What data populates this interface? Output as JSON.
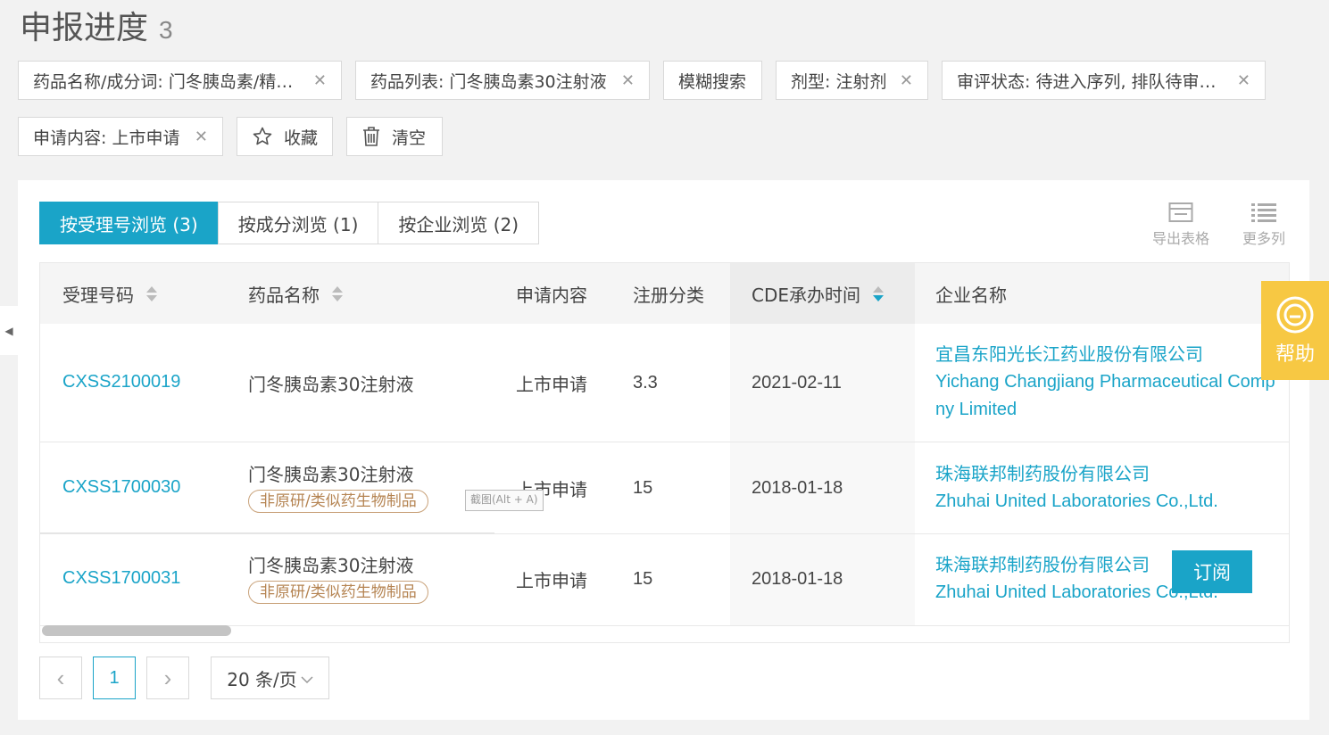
{
  "title": "申报进度",
  "result_count": "3",
  "filters": [
    {
      "label": "药品名称/成分词: 门冬胰岛素/精…",
      "removable": true
    },
    {
      "label": "药品列表: 门冬胰岛素30注射液",
      "removable": true
    },
    {
      "label": "模糊搜索",
      "removable": false
    },
    {
      "label": "剂型: 注射剂",
      "removable": true
    },
    {
      "label": "审评状态: 待进入序列, 排队待审…",
      "removable": true
    },
    {
      "label": "申请内容: 上市申请",
      "removable": true
    }
  ],
  "actions": {
    "favorite": "收藏",
    "clear": "清空"
  },
  "tabs": [
    {
      "label": "按受理号浏览 (3)",
      "active": true
    },
    {
      "label": "按成分浏览 (1)",
      "active": false
    },
    {
      "label": "按企业浏览 (2)",
      "active": false
    }
  ],
  "tools": {
    "export": "导出表格",
    "more_columns": "更多列"
  },
  "columns": [
    "受理号码",
    "药品名称",
    "申请内容",
    "注册分类",
    "CDE承办时间",
    "企业名称"
  ],
  "rows": [
    {
      "id": "CXSS2100019",
      "drug": "门冬胰岛素30注射液",
      "tag": "",
      "apply": "上市申请",
      "class": "3.3",
      "date": "2021-02-11",
      "company_cn": "宜昌东阳光长江药业股份有限公司",
      "company_en_1": "Yichang Changjiang Pharmaceutical Comp",
      "company_en_2": "ny Limited"
    },
    {
      "id": "CXSS1700030",
      "drug": "门冬胰岛素30注射液",
      "tag": "非原研/类似药生物制品",
      "apply": "上市申请",
      "class": "15",
      "date": "2018-01-18",
      "company_cn": "珠海联邦制药股份有限公司",
      "company_en_1": "Zhuhai United Laboratories Co.,Ltd.",
      "company_en_2": ""
    },
    {
      "id": "CXSS1700031",
      "drug": "门冬胰岛素30注射液",
      "tag": "非原研/类似药生物制品",
      "apply": "上市申请",
      "class": "15",
      "date": "2018-01-18",
      "company_cn": "珠海联邦制药股份有限公司",
      "company_en_1": "Zhuhai United Laboratories Co.,Ltd.",
      "company_en_2": ""
    }
  ],
  "subscribe": "订阅",
  "pagination": {
    "prev": "‹",
    "current": "1",
    "next": "›",
    "page_size": "20 条/页"
  },
  "help": "帮助",
  "screenshot_tip": "截图(Alt + A)",
  "colors": {
    "accent": "#1aa4c8",
    "help": "#f7c843",
    "tag": "#b58452"
  }
}
